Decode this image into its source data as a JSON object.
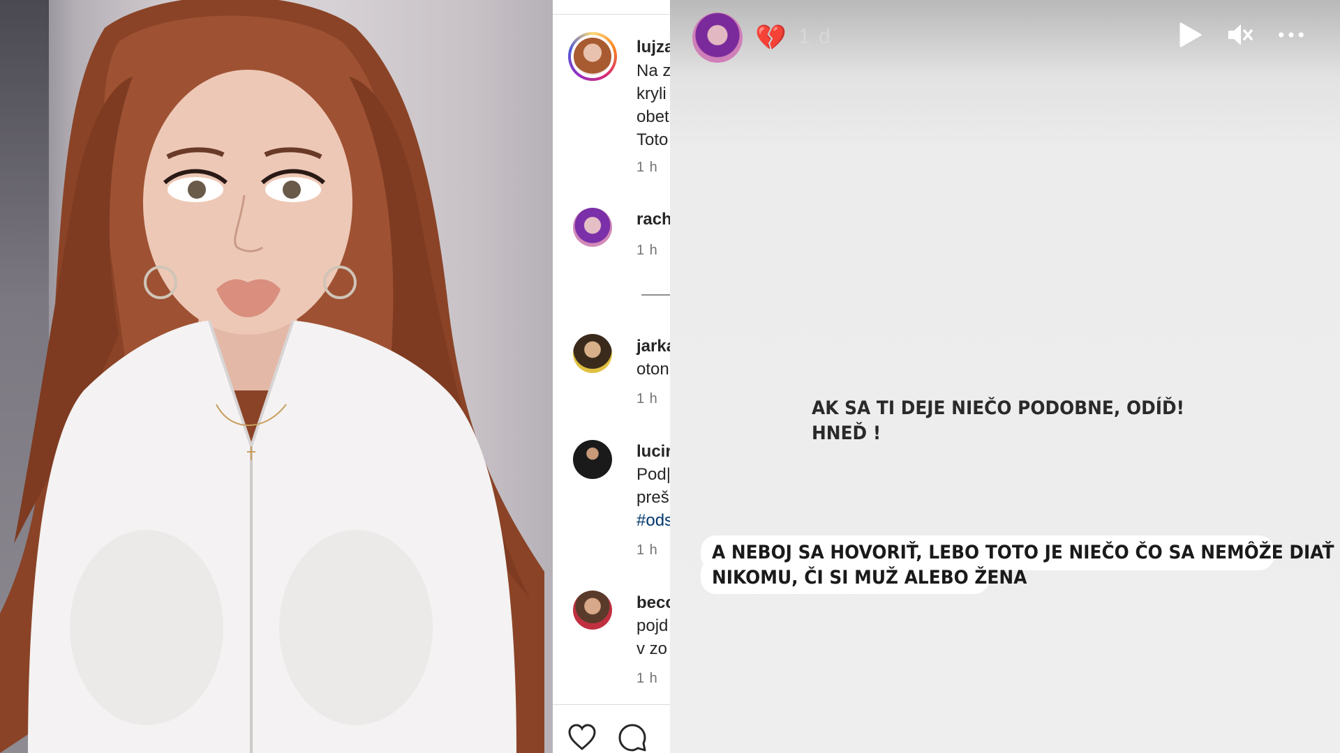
{
  "photo": {
    "icon": "woman-portrait-photo"
  },
  "comments": [
    {
      "username": "lujza",
      "lines": [
        "Na z",
        "kryli",
        "obet",
        "Toto"
      ],
      "time": "1 h",
      "has_story_ring": true
    },
    {
      "username": "rach",
      "lines": [],
      "time": "1 h",
      "has_story_ring": false
    },
    {
      "username": "jarka",
      "lines": [
        "oton"
      ],
      "time": "1 h",
      "has_story_ring": false
    },
    {
      "username": "lucir",
      "lines": [
        "Pod|",
        "preš"
      ],
      "hashtag": "#ods",
      "time": "1 h",
      "has_story_ring": false
    },
    {
      "username": "becc",
      "lines": [
        "pojd",
        "v zo"
      ],
      "time": "1 h",
      "has_story_ring": false
    }
  ],
  "actions": {
    "like_icon": "heart-icon",
    "comment_icon": "comment-bubble-icon"
  },
  "story": {
    "emoji": "💔",
    "time": "1 d",
    "controls": {
      "play": "play-icon",
      "mute": "muted-speaker-icon",
      "more": "more-icon"
    },
    "caption1_line1": "AK SA TI DEJE NIEČO PODOBNE, ODÍĎ!",
    "caption1_line2": "HNEĎ !",
    "caption2_line1": "A NEBOJ SA HOVORIŤ, LEBO TOTO JE NIEČO ČO SA NEMÔŽE DIAŤ",
    "caption2_line2": "NIKOMU, ČI SI MUŽ ALEBO ŽENA"
  },
  "colors": {
    "accent_link": "#00376b",
    "text": "#262626",
    "muted": "#737373"
  }
}
